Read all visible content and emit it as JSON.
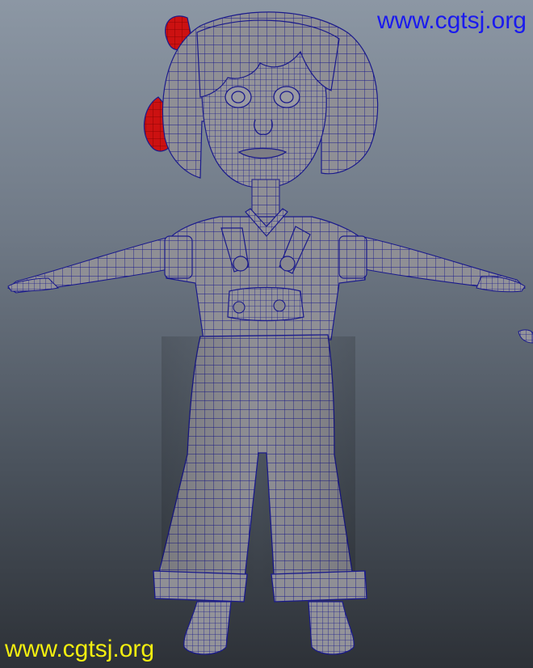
{
  "viewport": {
    "background_top": "#8c97a4",
    "background_bottom": "#2d3137"
  },
  "model": {
    "icon": "character-mesh-icon",
    "mesh_color": "#8f8f95",
    "mesh_shade": "#6b6b72",
    "wireframe_color": "#1a1a8c",
    "bow_color": "#cc1111"
  },
  "watermarks": {
    "top": {
      "text": "www.cgtsj.org",
      "color": "#1a1aee"
    },
    "bottom": {
      "text": "www.cgtsj.org",
      "color": "#f2ee10"
    }
  }
}
